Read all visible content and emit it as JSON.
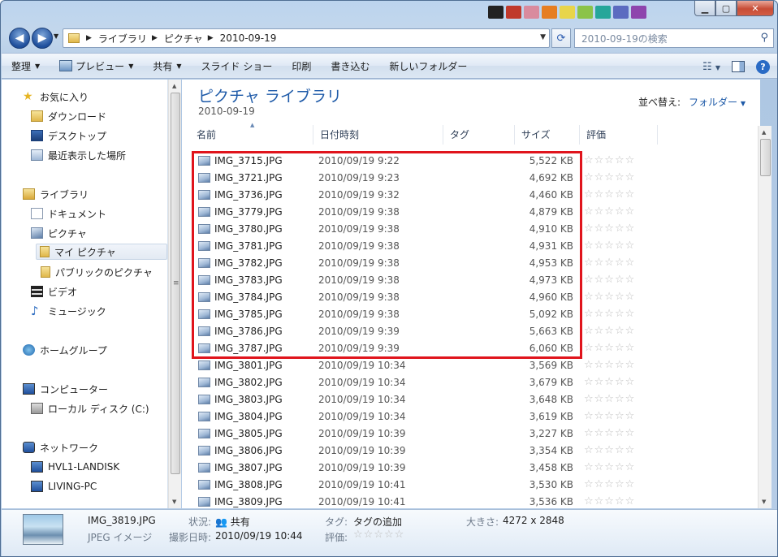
{
  "address": {
    "segments": [
      "ライブラリ",
      "ピクチャ",
      "2010-09-19"
    ]
  },
  "search": {
    "placeholder": "2010-09-19の検索"
  },
  "toolbar": {
    "organize": "整理",
    "preview": "プレビュー",
    "share": "共有",
    "slideshow": "スライド ショー",
    "print": "印刷",
    "burn": "書き込む",
    "new_folder": "新しいフォルダー",
    "help": "?"
  },
  "sidebar": {
    "favorites": "お気に入り",
    "downloads": "ダウンロード",
    "desktop": "デスクトップ",
    "recent": "最近表示した場所",
    "libraries": "ライブラリ",
    "documents": "ドキュメント",
    "pictures": "ピクチャ",
    "my_pictures": "マイ ピクチャ",
    "public_pictures": "パブリックのピクチャ",
    "videos": "ビデオ",
    "music": "ミュージック",
    "homegroup": "ホームグループ",
    "computer": "コンピューター",
    "local_disk": "ローカル ディスク (C:)",
    "network": "ネットワーク",
    "net1": "HVL1-LANDISK",
    "net2": "LIVING-PC"
  },
  "library": {
    "title": "ピクチャ ライブラリ",
    "subtitle": "2010-09-19",
    "arrange_label": "並べ替え:",
    "arrange_value": "フォルダー"
  },
  "columns": {
    "name": "名前",
    "date": "日付時刻",
    "tags": "タグ",
    "size": "サイズ",
    "rating": "評価"
  },
  "files": [
    {
      "name": "IMG_3715.JPG",
      "date": "2010/09/19 9:22",
      "size": "5,522 KB"
    },
    {
      "name": "IMG_3721.JPG",
      "date": "2010/09/19 9:23",
      "size": "4,692 KB"
    },
    {
      "name": "IMG_3736.JPG",
      "date": "2010/09/19 9:32",
      "size": "4,460 KB"
    },
    {
      "name": "IMG_3779.JPG",
      "date": "2010/09/19 9:38",
      "size": "4,879 KB"
    },
    {
      "name": "IMG_3780.JPG",
      "date": "2010/09/19 9:38",
      "size": "4,910 KB"
    },
    {
      "name": "IMG_3781.JPG",
      "date": "2010/09/19 9:38",
      "size": "4,931 KB"
    },
    {
      "name": "IMG_3782.JPG",
      "date": "2010/09/19 9:38",
      "size": "4,953 KB"
    },
    {
      "name": "IMG_3783.JPG",
      "date": "2010/09/19 9:38",
      "size": "4,973 KB"
    },
    {
      "name": "IMG_3784.JPG",
      "date": "2010/09/19 9:38",
      "size": "4,960 KB"
    },
    {
      "name": "IMG_3785.JPG",
      "date": "2010/09/19 9:38",
      "size": "5,092 KB"
    },
    {
      "name": "IMG_3786.JPG",
      "date": "2010/09/19 9:39",
      "size": "5,663 KB"
    },
    {
      "name": "IMG_3787.JPG",
      "date": "2010/09/19 9:39",
      "size": "6,060 KB"
    },
    {
      "name": "IMG_3801.JPG",
      "date": "2010/09/19 10:34",
      "size": "3,569 KB"
    },
    {
      "name": "IMG_3802.JPG",
      "date": "2010/09/19 10:34",
      "size": "3,679 KB"
    },
    {
      "name": "IMG_3803.JPG",
      "date": "2010/09/19 10:34",
      "size": "3,648 KB"
    },
    {
      "name": "IMG_3804.JPG",
      "date": "2010/09/19 10:34",
      "size": "3,619 KB"
    },
    {
      "name": "IMG_3805.JPG",
      "date": "2010/09/19 10:39",
      "size": "3,227 KB"
    },
    {
      "name": "IMG_3806.JPG",
      "date": "2010/09/19 10:39",
      "size": "3,354 KB"
    },
    {
      "name": "IMG_3807.JPG",
      "date": "2010/09/19 10:39",
      "size": "3,458 KB"
    },
    {
      "name": "IMG_3808.JPG",
      "date": "2010/09/19 10:41",
      "size": "3,530 KB"
    },
    {
      "name": "IMG_3809.JPG",
      "date": "2010/09/19 10:41",
      "size": "3,536 KB"
    }
  ],
  "rating_stars": "☆☆☆☆☆",
  "details": {
    "filename": "IMG_3819.JPG",
    "filetype": "JPEG イメージ",
    "status_label": "状況:",
    "status_value": "共有",
    "taken_label": "撮影日時:",
    "taken_value": "2010/09/19 10:44",
    "tags_label": "タグ:",
    "tags_value": "タグの追加",
    "rating_label": "評価:",
    "size_label": "大きさ:",
    "size_value": "4272 x 2848"
  },
  "highlight_color": "#e0141c",
  "accent_color": "#1e5aa8"
}
